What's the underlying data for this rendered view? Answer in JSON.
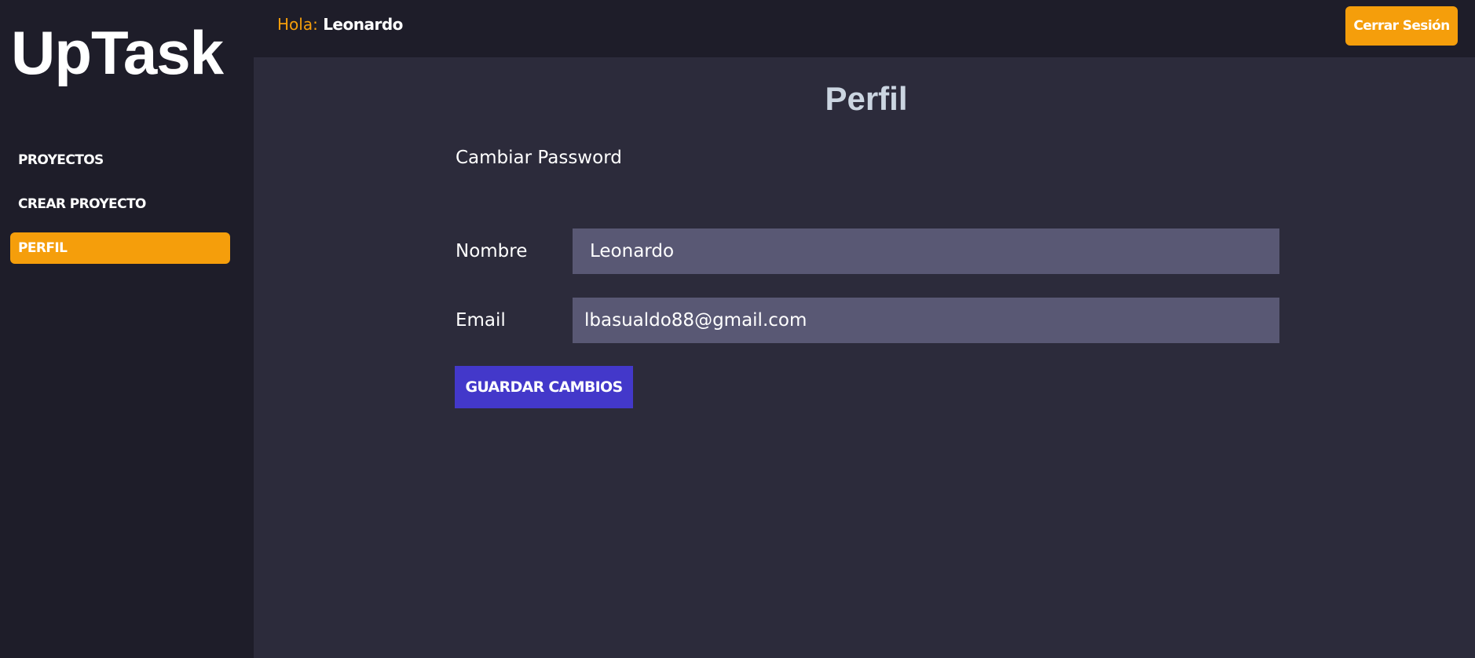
{
  "sidebar": {
    "logo": "UpTask",
    "items": [
      {
        "label": "PROYECTOS",
        "active": false
      },
      {
        "label": "CREAR PROYECTO",
        "active": false
      },
      {
        "label": "PERFIL",
        "active": true
      }
    ]
  },
  "header": {
    "greeting_prefix": "Hola:",
    "user_name": "Leonardo",
    "logout_label": "Cerrar Sesión"
  },
  "main": {
    "title": "Perfil",
    "change_password_link": "Cambiar Password",
    "form": {
      "name_label": "Nombre",
      "name_value": "Leonardo",
      "email_label": "Email",
      "email_value": "lbasualdo88@gmail.com",
      "submit_label": "GUARDAR CAMBIOS"
    }
  },
  "colors": {
    "accent": "#f59e0b",
    "primary_button": "#4338ca",
    "sidebar_bg": "#1e1d29",
    "content_bg": "#2c2b3b",
    "input_bg": "#595874"
  }
}
